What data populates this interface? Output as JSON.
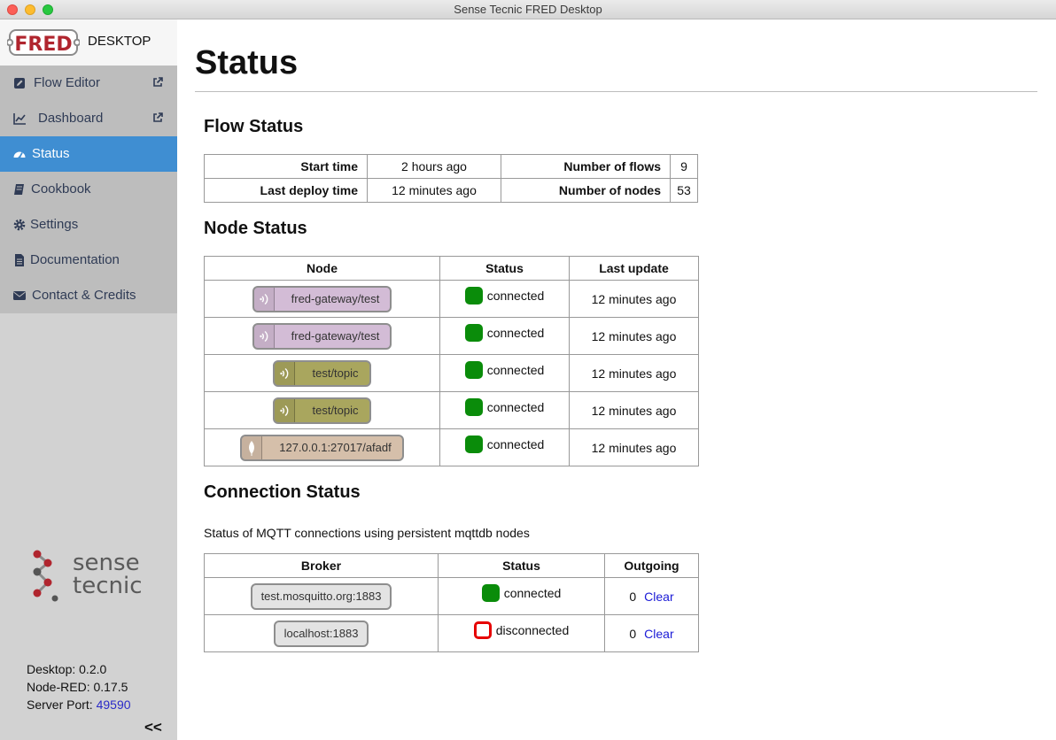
{
  "window": {
    "title": "Sense Tecnic FRED Desktop"
  },
  "brand": {
    "logo_text": "FRED",
    "desktop_label": "DESKTOP"
  },
  "sidebar": {
    "items": [
      {
        "label": "Flow Editor",
        "icon": "edit-icon",
        "external": true,
        "active": false
      },
      {
        "label": "Dashboard",
        "icon": "line-chart-icon",
        "external": true,
        "active": false
      },
      {
        "label": "Status",
        "icon": "tachometer-icon",
        "external": false,
        "active": true
      },
      {
        "label": "Cookbook",
        "icon": "book-icon",
        "external": false,
        "active": false
      },
      {
        "label": "Settings",
        "icon": "gear-icon",
        "external": false,
        "active": false
      },
      {
        "label": "Documentation",
        "icon": "file-text-icon",
        "external": false,
        "active": false
      },
      {
        "label": "Contact & Credits",
        "icon": "envelope-icon",
        "external": false,
        "active": false
      }
    ],
    "logo_line1": "sense",
    "logo_line2": "tecnic",
    "versions": {
      "desktop": "Desktop: 0.2.0",
      "nodered": "Node-RED: 0.17.5",
      "port_label": "Server Port: ",
      "port_value": "49590"
    },
    "collapse_label": "<<"
  },
  "page": {
    "title": "Status"
  },
  "flow_status": {
    "heading": "Flow Status",
    "start_time_label": "Start time",
    "start_time": "2 hours ago",
    "last_deploy_label": "Last deploy time",
    "last_deploy": "12 minutes ago",
    "flows_label": "Number of flows",
    "flows": "9",
    "nodes_label": "Number of nodes",
    "nodes": "53"
  },
  "node_status": {
    "heading": "Node Status",
    "headers": [
      "Node",
      "Status",
      "Last update"
    ],
    "rows": [
      {
        "node": "fred-gateway/test",
        "icon": "wifi-icon",
        "color": "#d3bcd6",
        "status": "connected",
        "last_update": "12 minutes ago"
      },
      {
        "node": "fred-gateway/test",
        "icon": "wifi-icon",
        "color": "#d3bcd6",
        "status": "connected",
        "last_update": "12 minutes ago"
      },
      {
        "node": "test/topic",
        "icon": "wifi-icon",
        "color": "#a9a65e",
        "status": "connected",
        "last_update": "12 minutes ago"
      },
      {
        "node": "test/topic",
        "icon": "wifi-icon",
        "color": "#a9a65e",
        "status": "connected",
        "last_update": "12 minutes ago"
      },
      {
        "node": "127.0.0.1:27017/afadf",
        "icon": "leaf-icon",
        "color": "#d5bfaa",
        "status": "connected",
        "last_update": "12 minutes ago"
      }
    ]
  },
  "connection_status": {
    "heading": "Connection Status",
    "description": "Status of MQTT connections using persistent mqttdb nodes",
    "headers": [
      "Broker",
      "Status",
      "Outgoing"
    ],
    "rows": [
      {
        "broker": "test.mosquitto.org:1883",
        "status": "connected",
        "outgoing": "0",
        "clear_label": "Clear"
      },
      {
        "broker": "localhost:1883",
        "status": "disconnected",
        "outgoing": "0",
        "clear_label": "Clear"
      }
    ]
  },
  "colors": {
    "accent": "#3f8ed2",
    "connected": "#0a8c0a",
    "disconnected": "#e60000",
    "sidebar_bg": "#d2d2d2",
    "link": "#1a1ad6"
  }
}
